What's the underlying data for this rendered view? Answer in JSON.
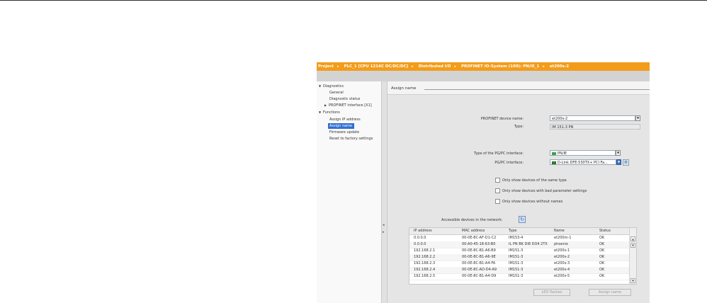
{
  "breadcrumb": [
    {
      "label": "Project"
    },
    {
      "label": "PLC_1 [CPU 1214C DC/DC/DC]"
    },
    {
      "label": "Distributed I/O"
    },
    {
      "label": "PROFINET IO-System (100): PN/IE_1"
    },
    {
      "label": "et200s-2"
    }
  ],
  "breadcrumb_sep": "▸",
  "nav": {
    "diagnostics": "Diagnostics",
    "general": "General",
    "diagnostic_status": "Diagnostic status",
    "profinet_interface": "PROFINET interface [X1]",
    "functions": "Functions",
    "assign_ip": "Assign IP address",
    "assign_name": "Assign name",
    "firmware_update": "Firmware update",
    "reset_factory": "Reset to factory settings"
  },
  "section": {
    "title": "Assign name"
  },
  "form": {
    "device_name_label": "PROFINET device name:",
    "device_name_value": "et200s-2",
    "type_label": "Type:",
    "type_value": "IM 151-3 PN",
    "pgpc_type_label": "Type of the PG/PC interface:",
    "pgpc_type_value": "PN/IE",
    "pgpc_interface_label": "PG/PC interface:",
    "pgpc_interface_value": "D-Link DFE-530TX+ PCI Fa..."
  },
  "filters": [
    {
      "label": "Only show devices of the same type",
      "checked": false
    },
    {
      "label": "Only show devices with bad parameter settings",
      "checked": false
    },
    {
      "label": "Only show devices without names",
      "checked": false
    }
  ],
  "accessible_label": "Accessible devices in the network:",
  "table": {
    "headers": [
      "IP address",
      "MAC address",
      "Type",
      "Name",
      "Status"
    ],
    "rows": [
      [
        "0.0.0.0",
        "00-0E-8C-AF-D1-C2",
        "IM153-4",
        "et200m-1",
        "OK"
      ],
      [
        "0.0.0.0",
        "00-A0-45-18-63-B0",
        "IL PN BK DI8 DO4 2TX",
        "phoenix",
        "OK"
      ],
      [
        "192.168.2.1",
        "00-0E-8C-B1-A6-B9",
        "IM151-3",
        "et200s-1",
        "OK"
      ],
      [
        "192.168.2.2",
        "00-0E-8C-B1-A6-9E",
        "IM151-3",
        "et200s-2",
        "OK"
      ],
      [
        "192.168.2.3",
        "00-0E-8C-B1-A4-FA",
        "IM151-3",
        "et200s-3",
        "OK"
      ],
      [
        "192.168.2.4",
        "00-0E-8C-AD-D4-A9",
        "IM151-3",
        "et200s-4",
        "OK"
      ],
      [
        "192.168.2.5",
        "00-0E-8C-B1-A4-D9",
        "IM151-3",
        "et200s-5",
        "OK"
      ]
    ]
  },
  "buttons": {
    "led_flashes": "LED flashes",
    "assign_name": "Assign name"
  },
  "colors": {
    "accent": "#f39c1a",
    "selection": "#2f6fd3"
  }
}
